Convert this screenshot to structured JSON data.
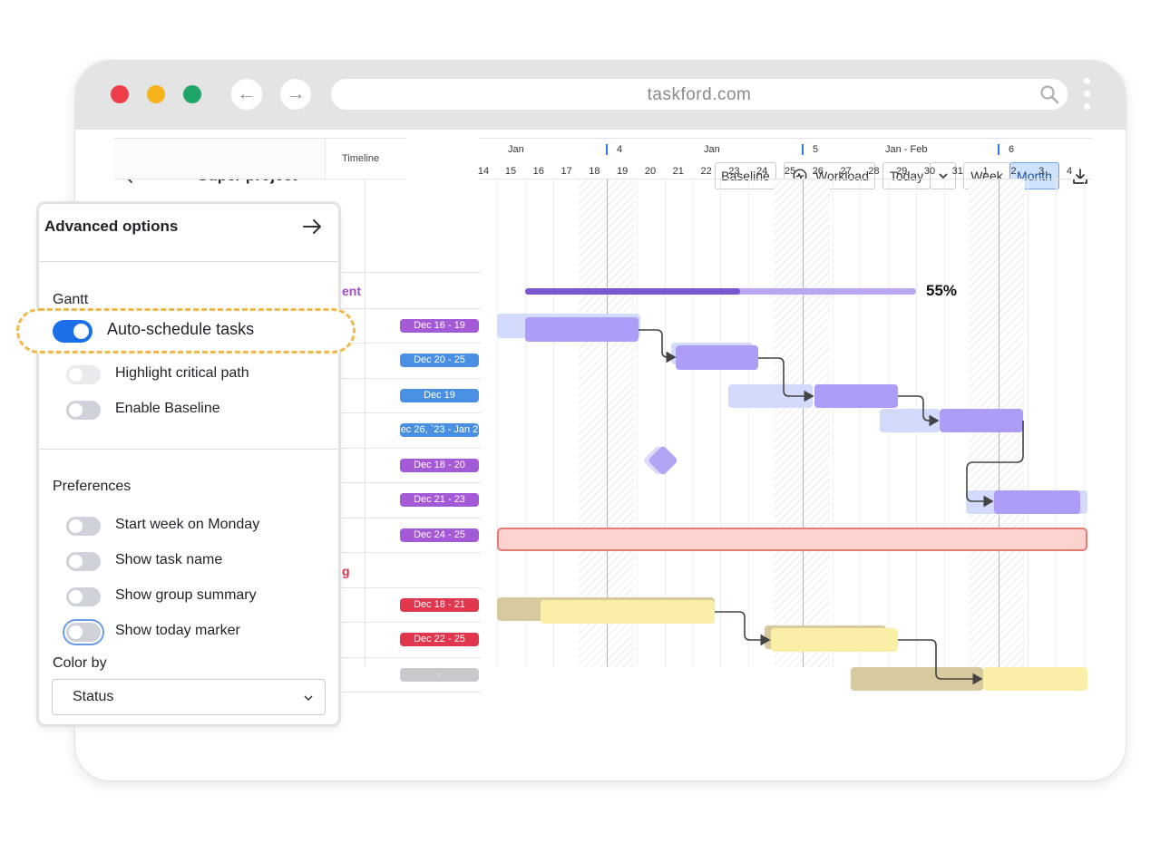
{
  "browser": {
    "url": "taskford.com",
    "traffic_lights": [
      "#ec3f4a",
      "#f5b21a",
      "#1fa56a"
    ]
  },
  "toolbar": {
    "back_label": "Back",
    "project_title": "Super project",
    "baseline_label": "Baseline",
    "workload_label": "Workload",
    "today_label": "Today",
    "week_label": "Week",
    "month_label": "Month"
  },
  "timeline": {
    "column_header": "Timeline",
    "months": [
      "Jan",
      "Jan",
      "Jan - Feb"
    ],
    "week_numbers": [
      "4",
      "5",
      "6"
    ],
    "days": [
      "14",
      "15",
      "16",
      "17",
      "18",
      "19",
      "20",
      "21",
      "22",
      "23",
      "24",
      "25",
      "26",
      "27",
      "28",
      "29",
      "30",
      "31",
      "1",
      "2",
      "3",
      "4"
    ]
  },
  "table": {
    "groups": [
      {
        "name_fragment": "ent",
        "color": "#a04cc8"
      },
      {
        "name_fragment": "g",
        "color": "#d8334a"
      }
    ],
    "rows": [
      {
        "dates": "Dec 16 - 19",
        "color": "#a45ad6"
      },
      {
        "dates": "Dec 20 - 25",
        "color": "#4a90e2"
      },
      {
        "dates": "Dec 19",
        "color": "#4a90e2"
      },
      {
        "dates": "ec 26, `23 - Jan 2",
        "color": "#4a90e2"
      },
      {
        "dates": "Dec 18 - 20",
        "color": "#a45ad6"
      },
      {
        "dates": "Dec 21 - 23",
        "color": "#a45ad6"
      },
      {
        "dates": "Dec 24 - 25",
        "color": "#a45ad6"
      },
      {
        "dates": "Dec 18 - 21",
        "color": "#e0374e"
      },
      {
        "dates": "Dec 22 - 25",
        "color": "#e0374e"
      },
      {
        "dates": "-",
        "color": "#c7c9cd"
      }
    ]
  },
  "gantt": {
    "summary_progress": "55%",
    "summary_progress_value": 0.55
  },
  "panel": {
    "title": "Advanced options",
    "gantt_section": "Gantt",
    "auto_schedule": {
      "label": "Auto-schedule tasks",
      "on": true
    },
    "highlight_critical": {
      "label": "Highlight critical path",
      "on": false
    },
    "enable_baseline": {
      "label": "Enable Baseline",
      "on": false
    },
    "preferences_section": "Preferences",
    "start_week_monday": {
      "label": "Start week on Monday",
      "on": false
    },
    "show_task_name": {
      "label": "Show task name",
      "on": false
    },
    "show_group_summary": {
      "label": "Show group summary",
      "on": false
    },
    "show_today_marker": {
      "label": "Show today marker",
      "on": false
    },
    "color_by_label": "Color by",
    "color_by_value": "Status"
  }
}
